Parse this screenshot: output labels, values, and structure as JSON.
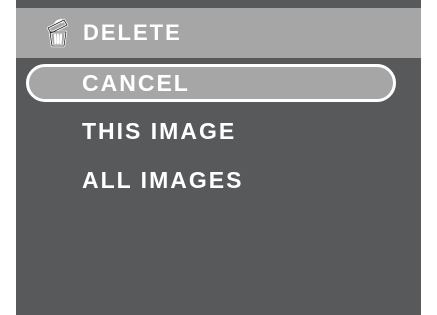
{
  "header": {
    "icon": "trash-can-icon",
    "title": "DELETE"
  },
  "menu": {
    "items": [
      {
        "label": "CANCEL",
        "selected": true
      },
      {
        "label": "THIS IMAGE",
        "selected": false
      },
      {
        "label": "ALL IMAGES",
        "selected": false
      }
    ]
  },
  "colors": {
    "background": "#58595b",
    "header_background": "#a6a6a6",
    "selected_background": "#a6a6a6",
    "text": "#ffffff",
    "selected_border": "#ffffff"
  }
}
